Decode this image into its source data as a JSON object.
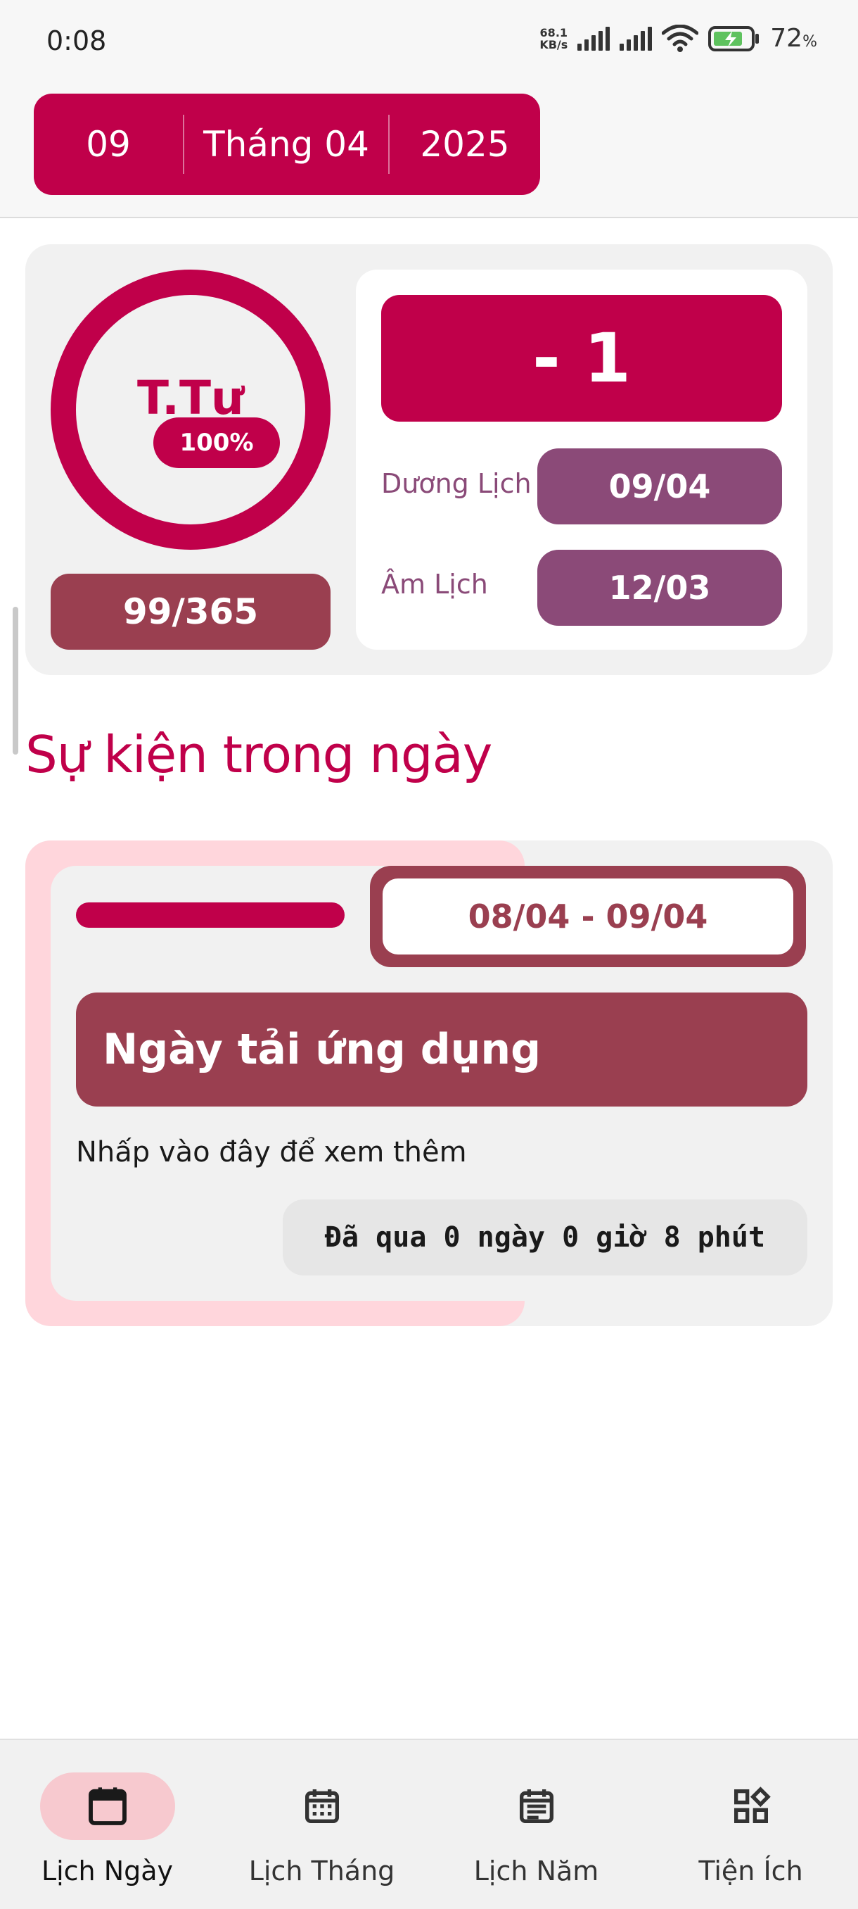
{
  "status_bar": {
    "time": "0:08",
    "net_speed_value": "68.1",
    "net_speed_unit": "KB/s",
    "battery_percent": "72",
    "battery_unit": "%"
  },
  "date_picker": {
    "day": "09",
    "month": "Tháng 04",
    "year": "2025"
  },
  "summary": {
    "weekday": "T.Tư",
    "progress_label": "100%",
    "progress": 1.0,
    "day_of_year": "99/365",
    "offset": "- 1",
    "solar_label": "Dương Lịch",
    "solar_date": "09/04",
    "lunar_label": "Âm Lịch",
    "lunar_date": "12/03"
  },
  "section": {
    "title": "Sự kiện trong ngày"
  },
  "event": {
    "date_range": "08/04 - 09/04",
    "title": "Ngày tải ứng dụng",
    "hint": "Nhấp vào đây để xem thêm",
    "elapsed": "Đã qua 0 ngày 0 giờ 8 phút"
  },
  "bottom_nav": {
    "items": [
      {
        "label": "Lịch Ngày",
        "icon": "calendar-day-icon",
        "active": true
      },
      {
        "label": "Lịch Tháng",
        "icon": "calendar-month-icon",
        "active": false
      },
      {
        "label": "Lịch Năm",
        "icon": "calendar-year-icon",
        "active": false
      },
      {
        "label": "Tiện Ích",
        "icon": "widgets-icon",
        "active": false
      }
    ]
  },
  "colors": {
    "primary": "#c0004a",
    "secondary": "#9a3f50",
    "tertiary": "#8b4a78",
    "accent_light": "#ffd6dc",
    "nav_active": "#f7c9cf"
  }
}
